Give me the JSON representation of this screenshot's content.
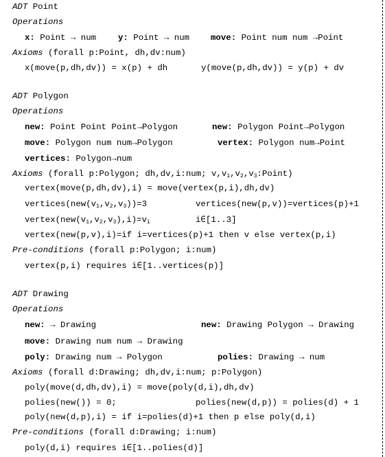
{
  "adts": [
    {
      "header_kw": "ADT",
      "name": "Point",
      "operations_label": "Operations",
      "operations_rows": [
        [
          {
            "name": "x:",
            "sig": " Point → num"
          },
          {
            "name": "y:",
            "sig": " Point → num"
          },
          {
            "name": "move:",
            "sig": " Point num num →Point"
          }
        ]
      ],
      "axioms_label": "Axioms",
      "axioms_quant": " (forall p:Point, dh,dv:num)",
      "axioms": [
        [
          "x(move(p,dh,dv)) = x(p) + dh",
          "y(move(p,dh,dv)) = y(p) + dv"
        ]
      ]
    },
    {
      "header_kw": "ADT",
      "name": "Polygon",
      "operations_label": "Operations",
      "operations_rows": [
        [
          {
            "name": "new:",
            "sig": " Point Point Point→Polygon"
          },
          {
            "name": "new:",
            "sig": " Polygon Point→Polygon"
          }
        ],
        [
          {
            "name": "move:",
            "sig": " Polygon num num→Polygon"
          },
          {
            "name": "vertex:",
            "sig": " Polygon num→Point"
          }
        ],
        [
          {
            "name": "vertices:",
            "sig": " Polygon→num"
          }
        ]
      ],
      "axioms_label": "Axioms",
      "axioms_quant": " (forall p:Polygon; dh,dv,i:num; v,v1,v2,v3:Point)",
      "axioms": [
        [
          "vertex(move(p,dh,dv),i) = move(vertex(p,i),dh,dv)"
        ],
        [
          "vertices(new(v1,v2,v3))=3",
          "vertices(new(p,v))=vertices(p)+1"
        ],
        [
          "vertex(new(v1,v2,v3),i)=vi",
          "i∈[1..3]"
        ],
        [
          "vertex(new(p,v),i)=if i=vertices(p)+1 then v else vertex(p,i)"
        ]
      ],
      "preconditions_label": "Pre-conditions",
      "preconditions_quant": " (forall p:Polygon; i:num)",
      "preconditions": [
        "vertex(p,i) requires i∈[1..vertices(p)]"
      ]
    },
    {
      "header_kw": "ADT",
      "name": "Drawing",
      "operations_label": "Operations",
      "operations_rows": [
        [
          {
            "name": "new:",
            "sig": " → Drawing"
          },
          {
            "name": "new:",
            "sig": " Drawing Polygon → Drawing"
          }
        ],
        [
          {
            "name": "move:",
            "sig": " Drawing num num → Drawing"
          }
        ],
        [
          {
            "name": "poly:",
            "sig": " Drawing num → Polygon"
          },
          {
            "name": "polies:",
            "sig": " Drawing → num"
          }
        ]
      ],
      "axioms_label": "Axioms",
      "axioms_quant": " (forall d:Drawing; dh,dv,i:num; p:Polygon)",
      "axioms": [
        [
          "poly(move(d,dh,dv),i) = move(poly(d,i),dh,dv)"
        ],
        [
          "polies(new()) = 0;",
          "polies(new(d,p)) = polies(d) + 1"
        ],
        [
          "poly(new(d,p),i) = if i=polies(d)+1 then p else poly(d,i)"
        ]
      ],
      "preconditions_label": "Pre-conditions",
      "preconditions_quant": " (forall d:Drawing; i:num)",
      "preconditions": [
        "poly(d,i) requires i∈[1..polies(d)]"
      ]
    }
  ]
}
